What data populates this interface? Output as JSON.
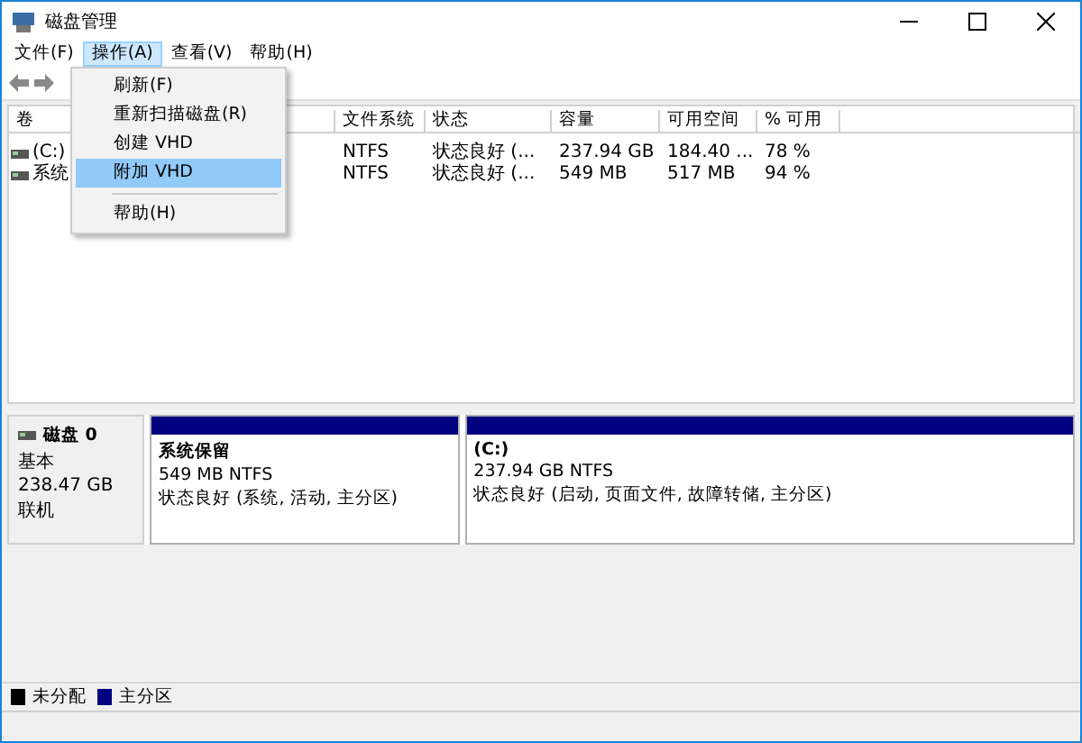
{
  "window": {
    "title": "磁盘管理"
  },
  "menu_bar": [
    {
      "label": "文件(F)",
      "selected": false
    },
    {
      "label": "操作(A)",
      "selected": true
    },
    {
      "label": "查看(V)",
      "selected": false
    },
    {
      "label": "帮助(H)",
      "selected": false
    }
  ],
  "open_menu": {
    "items": [
      {
        "kind": "item",
        "label": "刷新(F)",
        "selected": false
      },
      {
        "kind": "item",
        "label": "重新扫描磁盘(R)",
        "selected": false
      },
      {
        "kind": "item",
        "label": "创建 VHD",
        "selected": false
      },
      {
        "kind": "item",
        "label": "附加 VHD",
        "selected": true
      },
      {
        "kind": "separator"
      },
      {
        "kind": "item",
        "label": "帮助(H)",
        "selected": false
      }
    ]
  },
  "volume_table": {
    "columns": [
      "卷",
      "文件系统",
      "状态",
      "容量",
      "可用空间",
      "% 可用"
    ],
    "rows": [
      [
        "(C:)",
        "NTFS",
        "状态良好 (...",
        "237.94 GB",
        "184.40 ...",
        "78 %"
      ],
      [
        "系统",
        "NTFS",
        "状态良好 (...",
        "549 MB",
        "517 MB",
        "94 %"
      ]
    ]
  },
  "disk": {
    "name": "磁盘 0",
    "type": "基本",
    "size": "238.47 GB",
    "status": "联机",
    "partitions": [
      {
        "name": "系统保留",
        "detail": "549 MB NTFS",
        "status": "状态良好 (系统, 活动, 主分区)"
      },
      {
        "name": "(C:)",
        "detail": "237.94 GB NTFS",
        "status": "状态良好 (启动, 页面文件, 故障转储, 主分区)"
      }
    ]
  },
  "legend": [
    {
      "label": "未分配",
      "color": "#000000"
    },
    {
      "label": "主分区",
      "color": "#000080"
    }
  ]
}
